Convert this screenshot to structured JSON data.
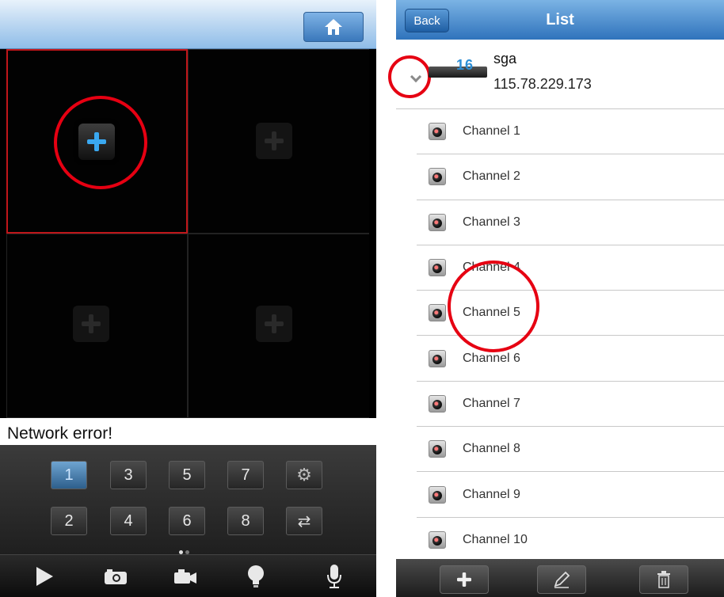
{
  "left_panel": {
    "status_text": "Network error!",
    "number_buttons": [
      "1",
      "3",
      "5",
      "7",
      "2",
      "4",
      "6",
      "8"
    ],
    "selected_number": "1",
    "side_buttons": [
      "settings",
      "switch"
    ],
    "page_dots": 2,
    "toolbar": [
      "play",
      "snapshot",
      "record",
      "light",
      "microphone"
    ]
  },
  "right_panel": {
    "back_label": "Back",
    "title": "List",
    "device": {
      "badge": "16",
      "name": "sga",
      "ip": "115.78.229.173"
    },
    "channels": [
      "Channel 1",
      "Channel 2",
      "Channel 3",
      "Channel 4",
      "Channel 5",
      "Channel 6",
      "Channel 7",
      "Channel 8",
      "Channel 9",
      "Channel 10"
    ],
    "bottom_actions": [
      "add",
      "edit",
      "delete"
    ]
  },
  "colors": {
    "accent_blue": "#3aa8f0",
    "highlight_red": "#e60012",
    "header_blue": "#2f73bc"
  }
}
